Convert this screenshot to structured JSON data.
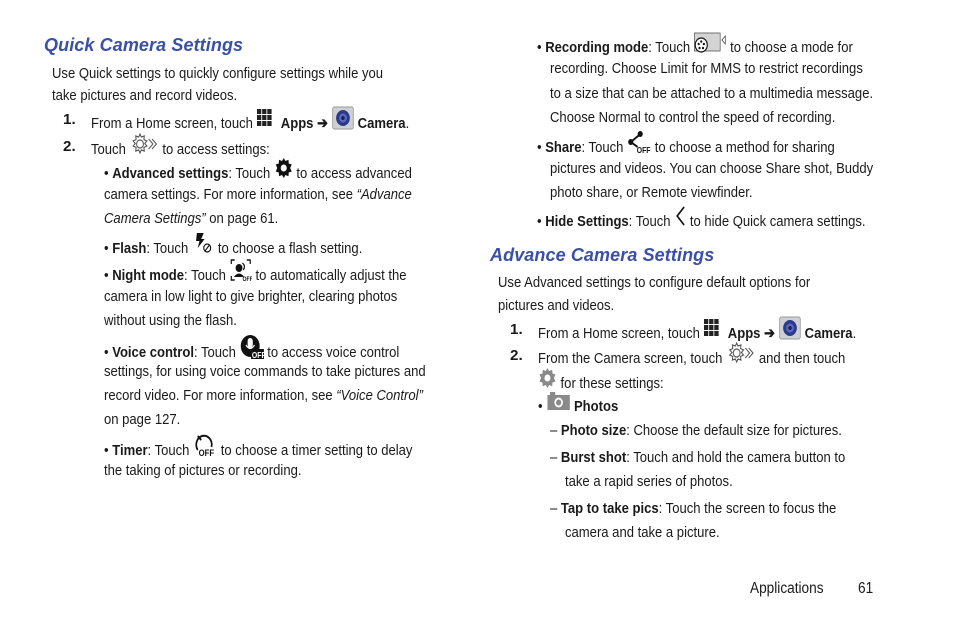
{
  "left": {
    "heading": "Quick Camera Settings",
    "intro": [
      "Use Quick settings to quickly configure settings while you",
      "take pictures and record videos."
    ],
    "step1": {
      "num": "1.",
      "pre": "From a Home screen, touch ",
      "apps": "Apps",
      "arrow": " ➔ ",
      "camera": "Camera",
      "post": "."
    },
    "step2": {
      "num": "2.",
      "pre": "Touch ",
      "post": " to access settings:"
    },
    "bullets": {
      "advanced": {
        "title": "Advanced settings",
        "l1a": ": Touch ",
        "l1b": " to access advanced",
        "l2a": "camera settings. For more information, see ",
        "l2b": "“Advance",
        "l3a": "Camera Settings”",
        "l3b": " on page 61."
      },
      "flash": {
        "title": "Flash",
        "a": ": Touch ",
        "b": " to choose a flash setting."
      },
      "night": {
        "title": "Night mode",
        "a": ": Touch ",
        "b": " to automatically adjust the",
        "l2": "camera in low light to give brighter, clearing photos",
        "l3": "without using the flash."
      },
      "voice": {
        "title": "Voice control",
        "a": ": Touch ",
        "b": " to access voice control",
        "l2": "settings, for using voice commands to take pictures and",
        "l3a": "record video. For more information, see ",
        "l3b": "“Voice Control”",
        "l4": "on page 127."
      },
      "timer": {
        "title": "Timer",
        "a": ": Touch ",
        "b": " to choose a timer setting to delay",
        "l2": "the taking of pictures or recording."
      }
    }
  },
  "right": {
    "recording": {
      "title": "Recording mode",
      "a": ": Touch ",
      "b": " to choose a mode for",
      "l2": "recording. Choose Limit for MMS to restrict recordings",
      "l3": "to a size that can be attached to a multimedia message.",
      "l4": "Choose Normal to control the speed of recording."
    },
    "share": {
      "title": "Share",
      "a": ": Touch ",
      "b": " to choose a method for sharing",
      "l2": "pictures and videos. You can choose Share shot, Buddy",
      "l3": "photo share, or Remote viewfinder."
    },
    "hide": {
      "title": "Hide Settings",
      "a": ": Touch ",
      "b": " to hide Quick camera settings."
    },
    "heading": "Advance Camera Settings",
    "intro": [
      "Use Advanced settings to configure default options for",
      "pictures and videos."
    ],
    "step1": {
      "num": "1.",
      "pre": "From a Home screen, touch ",
      "apps": "Apps",
      "arrow": " ➔ ",
      "camera": "Camera",
      "post": "."
    },
    "step2": {
      "num": "2.",
      "pre": "From the Camera screen, touch ",
      "post": " and then touch",
      "l2": " for these settings:"
    },
    "photos": "Photos",
    "subitems": {
      "size": {
        "title": "Photo size",
        "text": ": Choose the default size for pictures."
      },
      "burst": {
        "title": "Burst shot",
        "text": ": Touch and hold the camera button to",
        "l2": "take a rapid series of photos."
      },
      "tap": {
        "title": "Tap to take pics",
        "text": ": Touch the screen to focus the",
        "l2": "camera and take a picture."
      }
    },
    "dash": "–",
    "bullet": "•"
  },
  "footer": {
    "section": "Applications",
    "page": "61"
  },
  "colors": {
    "heading": "#3a4fa6",
    "icon_gray": "#8a8a8a",
    "camera_blue": "#2c3a8a"
  }
}
